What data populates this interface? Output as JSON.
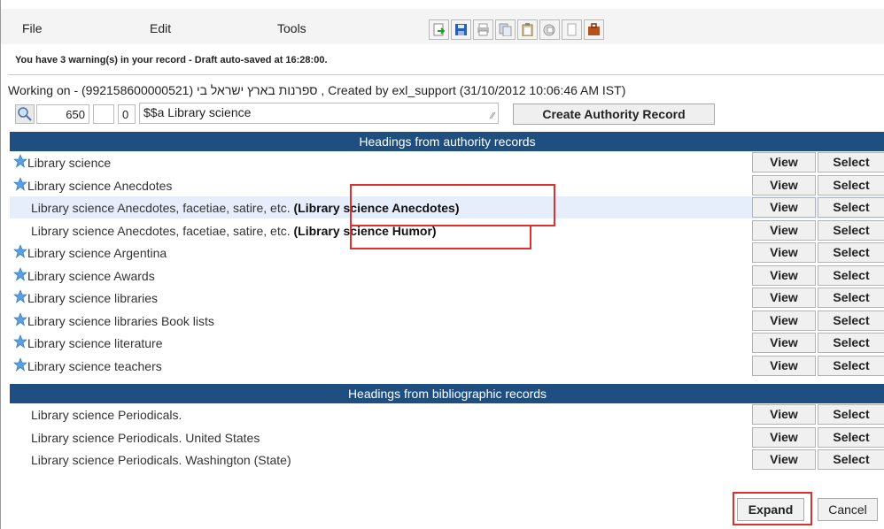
{
  "menu": {
    "file": "File",
    "edit": "Edit",
    "tools": "Tools"
  },
  "toolbar_icons": [
    "add-record-icon",
    "save-icon",
    "print-icon",
    "copy-icon",
    "clipboard-icon",
    "stack-icon",
    "blank-page-icon",
    "briefcase-icon"
  ],
  "warning": "You have 3 warning(s) in your record - Draft auto-saved at 16:28:00.",
  "working_on": "Working on - (992158600000521) ספרנות בארץ ישראל בי , Created by exl_support (31/10/2012 10:06:46 AM IST)",
  "field": {
    "tag": "650",
    "ind1": "",
    "ind2": "0",
    "subfield": "$$a Library science"
  },
  "create_authority_label": "Create Authority Record",
  "authority_header": "Headings from authority records",
  "bibliographic_header": "Headings from bibliographic records",
  "authority_rows": [
    {
      "label": "Library science",
      "note": "",
      "starred": true
    },
    {
      "label": "Library science Anecdotes",
      "note": "",
      "starred": true
    },
    {
      "label": "Library science Anecdotes, facetiae, satire, etc.",
      "note": "(Library science Anecdotes)",
      "starred": false
    },
    {
      "label": "Library science Anecdotes, facetiae, satire, etc.",
      "note": "(Library science Humor)",
      "starred": false
    },
    {
      "label": "Library science Argentina",
      "note": "",
      "starred": true
    },
    {
      "label": "Library science Awards",
      "note": "",
      "starred": true
    },
    {
      "label": "Library science libraries",
      "note": "",
      "starred": true
    },
    {
      "label": "Library science libraries Book lists",
      "note": "",
      "starred": true
    },
    {
      "label": "Library science literature",
      "note": "",
      "starred": true
    },
    {
      "label": "Library science teachers",
      "note": "",
      "starred": true
    }
  ],
  "bibliographic_rows": [
    {
      "label": "Library science Periodicals."
    },
    {
      "label": "Library science Periodicals. United States"
    },
    {
      "label": "Library science Periodicals. Washington (State)"
    }
  ],
  "buttons": {
    "view": "View",
    "select": "Select",
    "expand": "Expand",
    "cancel": "Cancel"
  },
  "colors": {
    "header_bg": "#1f4e80",
    "highlight_row": "#e6eefb",
    "annotation_red": "#e0302e",
    "star": "#5aa0e0"
  }
}
